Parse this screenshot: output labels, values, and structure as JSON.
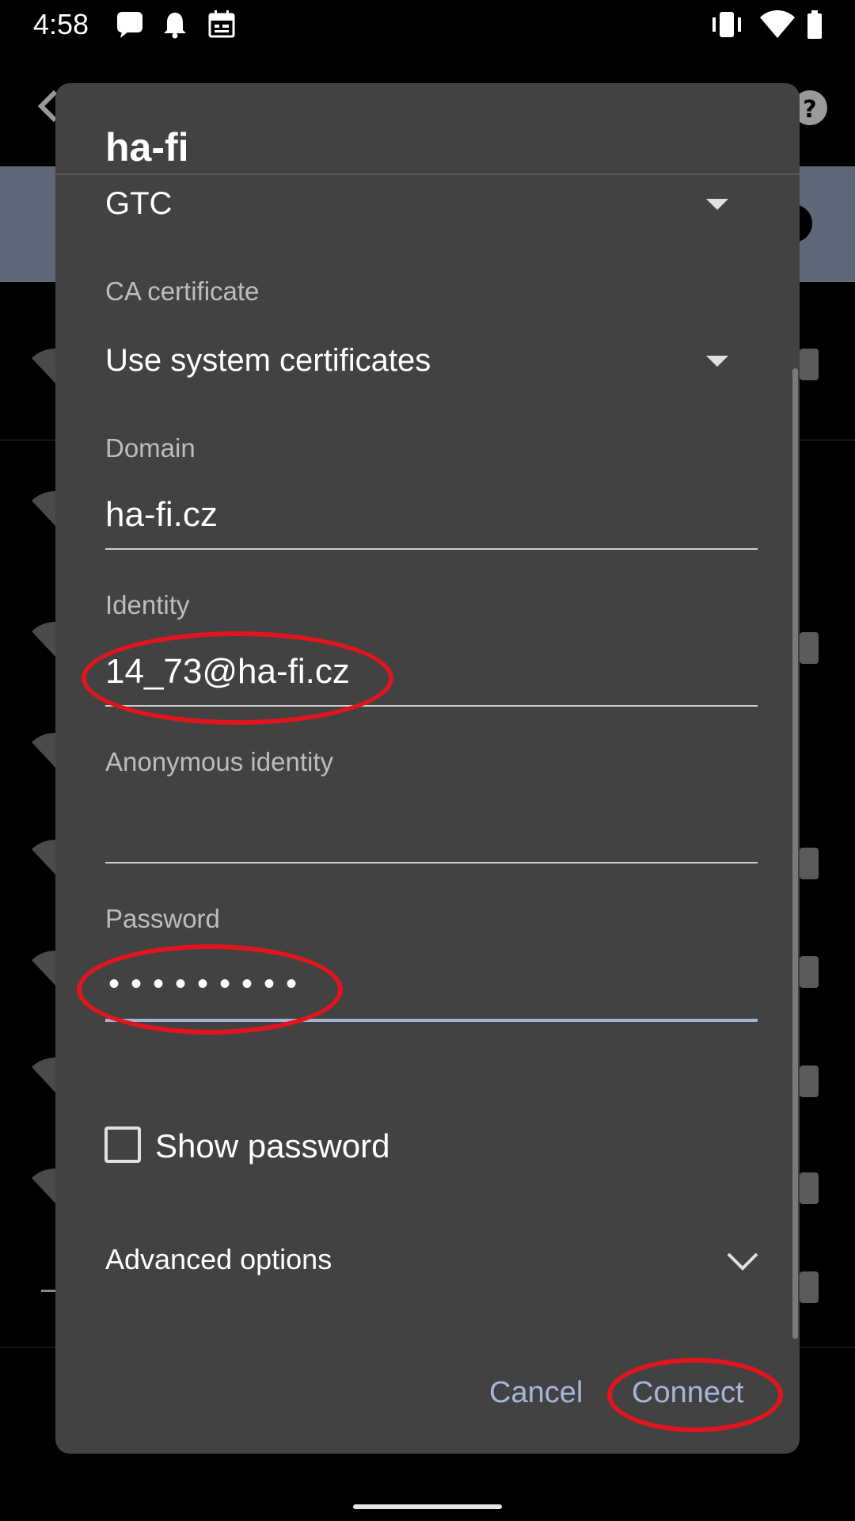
{
  "status_bar": {
    "time": "4:58",
    "icons": [
      "message-icon",
      "notification-bell-icon",
      "calendar-icon",
      "vibrate-icon",
      "wifi-icon",
      "battery-icon"
    ]
  },
  "dialog": {
    "title": "ha-fi",
    "phase2": {
      "value": "GTC"
    },
    "ca_certificate": {
      "label": "CA certificate",
      "value": "Use system certificates"
    },
    "domain": {
      "label": "Domain",
      "value": "ha-fi.cz"
    },
    "identity": {
      "label": "Identity",
      "value": "14_73@ha-fi.cz"
    },
    "anonymous_identity": {
      "label": "Anonymous identity",
      "value": ""
    },
    "password": {
      "label": "Password",
      "masked_value": "•••••••••"
    },
    "show_password": {
      "label": "Show password",
      "checked": false
    },
    "advanced_options": {
      "label": "Advanced options"
    },
    "buttons": {
      "cancel": "Cancel",
      "connect": "Connect"
    }
  },
  "colors": {
    "dialog_bg": "#424242",
    "accent": "#a7b5d8",
    "annotation": "#e2151f"
  }
}
